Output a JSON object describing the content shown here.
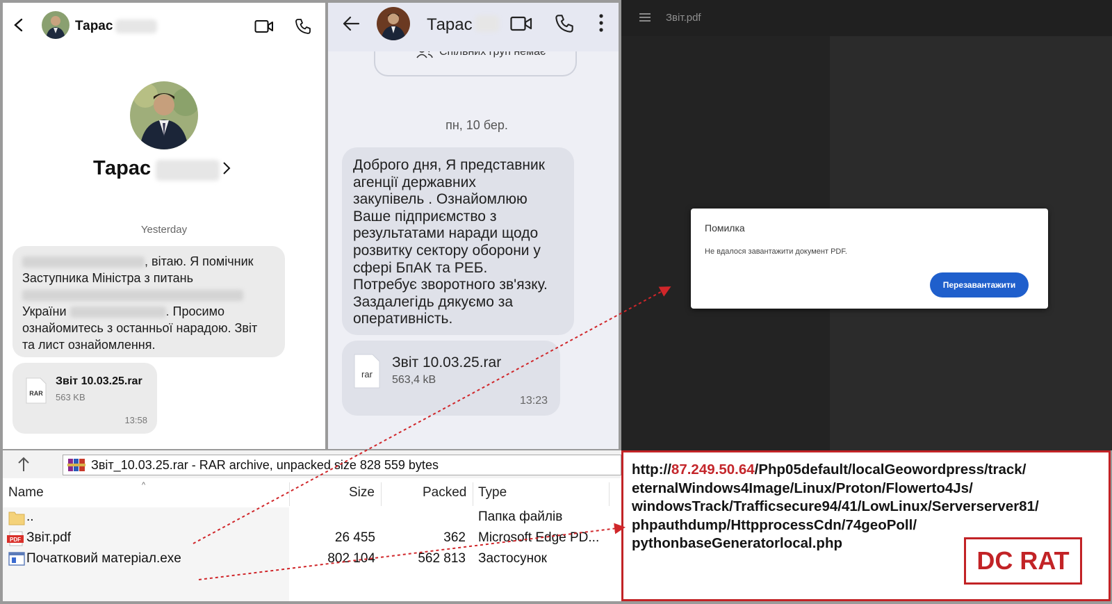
{
  "messenger1": {
    "contact_name": "Тарас",
    "day_label": "Yesterday",
    "message_lines": [
      {
        "hidden": true,
        "text": ", вітаю. Я помічник"
      },
      {
        "hidden": false,
        "text": "Заступника Міністра з питань"
      },
      {
        "hidden": true,
        "text": ""
      },
      {
        "hidden": false,
        "text": "України"
      },
      {
        "hidden": false,
        "text": "ознайомитесь з останньої нарадою. Звіт"
      },
      {
        "hidden": false,
        "text": "та лист ознайомлення."
      }
    ],
    "message_line4_tail": ". Просимо",
    "file": {
      "icon_label": "RAR",
      "name": "Звіт 10.03.25.rar",
      "size": "563 KB",
      "time": "13:58"
    }
  },
  "messenger2": {
    "contact_name": "Тарас",
    "common_groups": "Спільних груп немає",
    "day_label": "пн, 10 бер.",
    "message_lines": [
      "Доброго дня, Я представник",
      "агенції державних",
      "закупівель . Ознайомлюю",
      "Ваше підприємство з",
      "результатами наради щодо",
      "розвитку сектору оборони у",
      "сфері БпАК та РЕБ.",
      "Потребує зворотного зв'язку.",
      "Заздалегідь дякуємо за",
      "оперативність."
    ],
    "file": {
      "icon_label": "rar",
      "name": "Звіт 10.03.25.rar",
      "size": "563,4 kB",
      "time": "13:23"
    }
  },
  "pdf_viewer": {
    "title": "Звіт.pdf",
    "dialog": {
      "title": "Помилка",
      "message": "Не вдалося завантажити документ PDF.",
      "button": "Перезавантажити"
    }
  },
  "winrar": {
    "address": "Звіт_10.03.25.rar - RAR archive, unpacked size 828 559 bytes",
    "columns": {
      "name": "Name",
      "size": "Size",
      "packed": "Packed",
      "type": "Type"
    },
    "rows": [
      {
        "icon": "folder-icon",
        "name": "..",
        "size": "",
        "packed": "",
        "type": "Папка файлів"
      },
      {
        "icon": "pdf-icon",
        "name": "Звіт.pdf",
        "size": "26 455",
        "packed": "362",
        "type": "Microsoft Edge PD..."
      },
      {
        "icon": "exe-icon",
        "name": "Початковий матеріал.exe",
        "size": "802 104",
        "packed": "562 813",
        "type": "Застосунок"
      }
    ]
  },
  "url_panel": {
    "url_prefix": "http://",
    "ip": "87.249.50.64",
    "line1_rest": "/Php05default/localGeowordpress/track/",
    "line2": "eternalWindows4Image/Linux/Proton/Flowerto4Js/",
    "line3": "windowsTrack/Trafficsecure94/41/LowLinux/Serverserver81/",
    "line4": "phpauthdump/HttpprocessCdn/74geoPoll/",
    "line5": "pythonbaseGeneratorlocal.php",
    "badge": "DC RAT"
  },
  "colors": {
    "accent_red": "#c22326",
    "button_blue": "#1f5fcc",
    "dark_bg": "#2b2b2b"
  }
}
